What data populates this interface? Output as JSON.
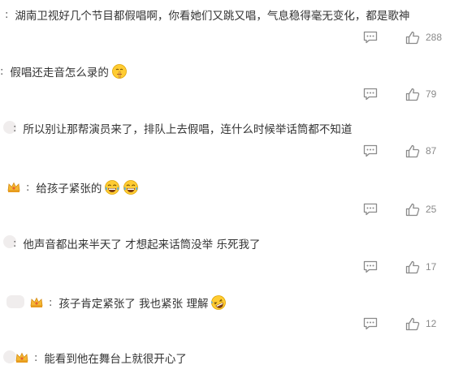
{
  "comments": [
    {
      "text": "湖南卫视好几个节目都假唱啊，你看她们又跳又唱，气息稳得毫无变化，都是歌神",
      "likes": "288",
      "emoji": [],
      "badge": false
    },
    {
      "text": "假唱还走音怎么录的",
      "likes": "79",
      "emoji": [
        "shushing-face"
      ],
      "badge": false
    },
    {
      "text": "所以别让那帮演员来了，排队上去假唱，连什么时候举话筒都不知道",
      "likes": "87",
      "emoji": [],
      "badge": false
    },
    {
      "text": "给孩子紧张的",
      "likes": "25",
      "emoji": [
        "tears-of-joy",
        "tears-of-joy"
      ],
      "badge": true
    },
    {
      "text": "他声音都出来半天了 才想起来话筒没举 乐死我了",
      "likes": "17",
      "emoji": [],
      "badge": false
    },
    {
      "text": "孩子肯定紧张了 我也紧张 理解",
      "likes": "12",
      "emoji": [
        "rolling-laughing"
      ],
      "badge": true
    },
    {
      "text": "能看到他在舞台上就很开心了",
      "likes": "",
      "emoji": [],
      "badge": true
    }
  ],
  "colors": {
    "text": "#333333",
    "icon": "#8a8a8a",
    "emoji_face": "#FFCC33"
  }
}
